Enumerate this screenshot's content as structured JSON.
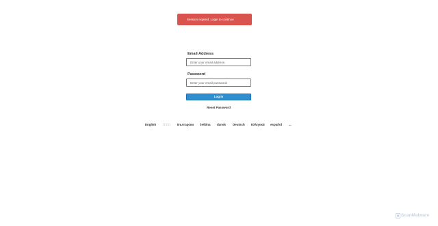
{
  "alert": {
    "message": "Session expired. Login to continue"
  },
  "form": {
    "email_label": "Email Address",
    "email_placeholder": "Enter your email address.",
    "email_value": "",
    "password_label": "Password",
    "password_placeholder": "Enter your email password.",
    "password_value": "",
    "login_label": "Log in",
    "reset_label": "Reset Password"
  },
  "languages": [
    {
      "label": "English"
    },
    {
      "label": "□□□□"
    },
    {
      "label": "Български"
    },
    {
      "label": "čeština"
    },
    {
      "label": "dansk"
    },
    {
      "label": "Deutsch"
    },
    {
      "label": "Ελληνικά"
    },
    {
      "label": "español"
    },
    {
      "label": "..."
    }
  ],
  "watermark": {
    "text": "ScanMalware"
  },
  "colors": {
    "alert_bg": "#d9534f",
    "button_bg": "#2d8fd1",
    "watermark": "#c9d4e0"
  }
}
